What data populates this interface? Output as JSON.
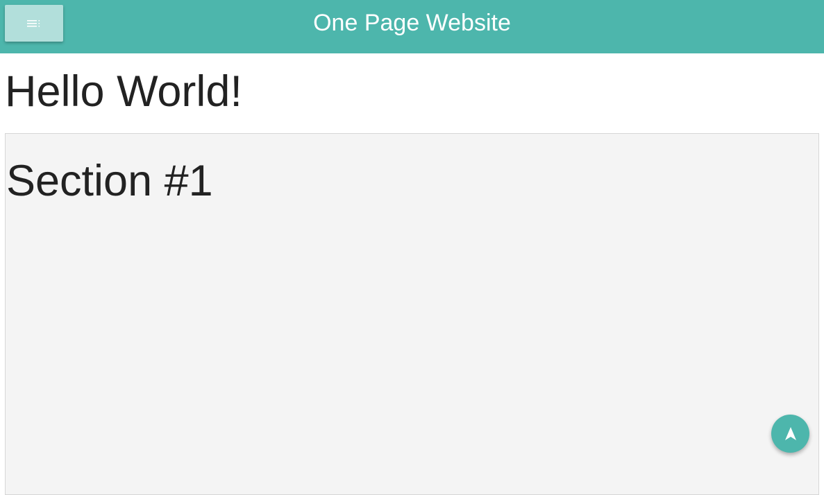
{
  "header": {
    "title": "One Page Website",
    "menu_icon": "menu-icon",
    "color": "#4db6ac",
    "menu_button_color": "#b2dfdb"
  },
  "main": {
    "heading": "Hello World!",
    "sections": [
      {
        "title": "Section #1"
      }
    ]
  },
  "fab": {
    "icon": "navigation-arrow-icon",
    "color": "#4db6ac"
  }
}
